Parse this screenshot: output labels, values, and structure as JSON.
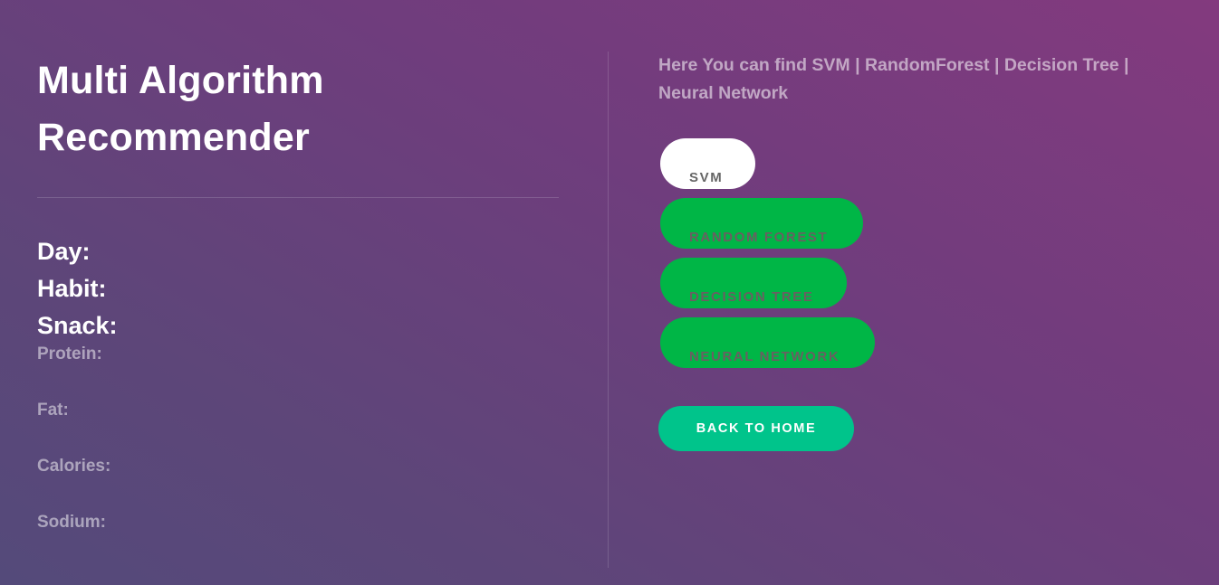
{
  "header": {
    "title_line1": "Multi Algorithm",
    "title_line2": "Recommender"
  },
  "info": {
    "day_label": "Day:",
    "habit_label": "Habit:",
    "snack_label": "Snack:",
    "protein_label": "Protein:",
    "fat_label": "Fat:",
    "calories_label": "Calories:",
    "sodium_label": "Sodium:"
  },
  "description": {
    "text": "Here You can find SVM | RandomForest | Decision Tree | Neural Network"
  },
  "algorithms": {
    "svm": "SVM",
    "random_forest": "RANDOM FOREST",
    "decision_tree": "DECISION TREE",
    "neural_network": "NEURAL NETWORK",
    "selected": "SVM"
  },
  "actions": {
    "back_label": "BACK TO HOME"
  },
  "colors": {
    "accent_green": "#00b646",
    "back_button": "#00c48b",
    "selected_button": "#ffffff"
  }
}
